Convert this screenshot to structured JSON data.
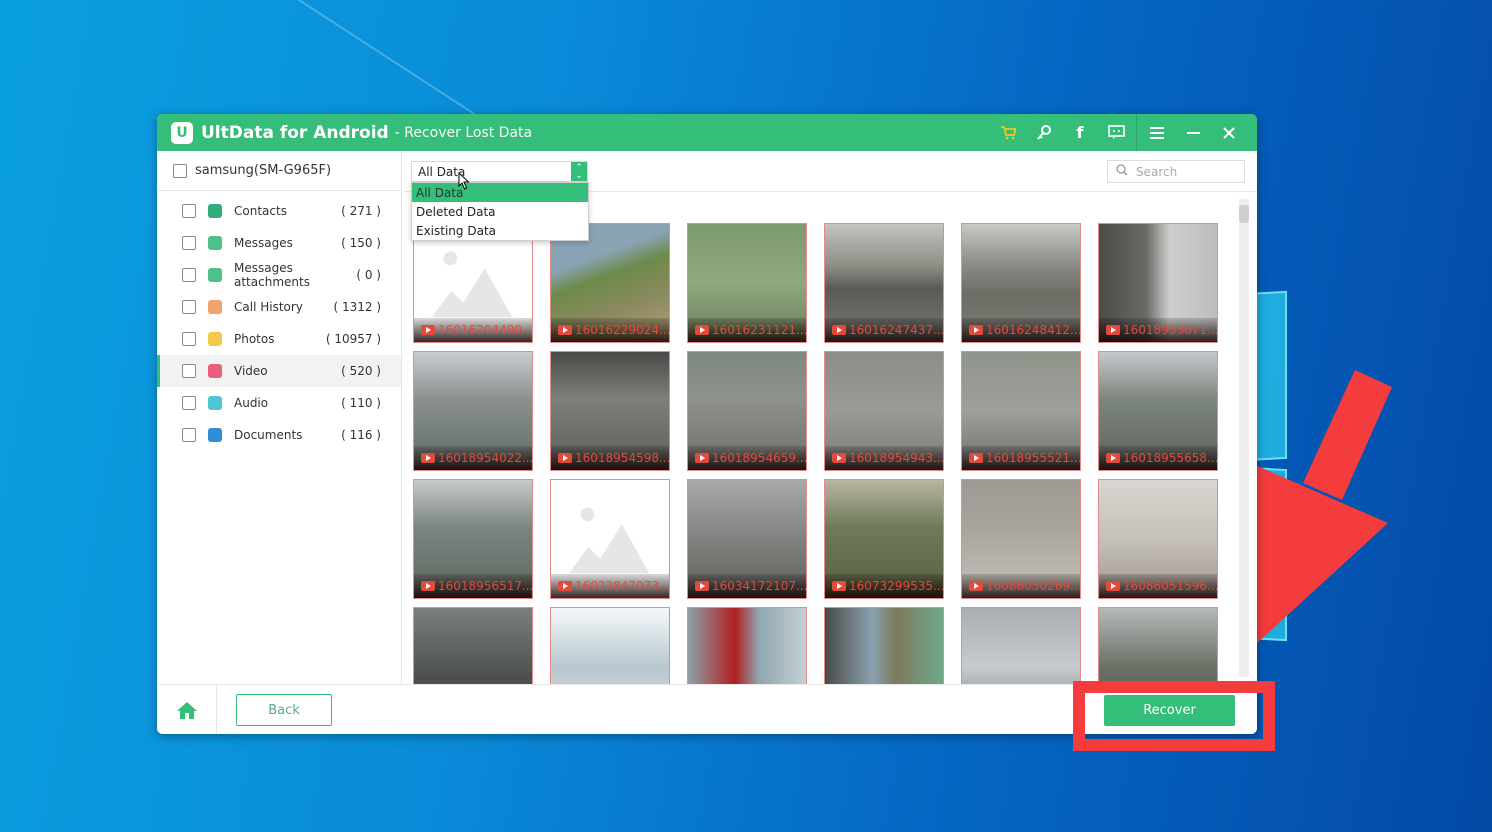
{
  "window": {
    "app_name": "UltData for Android",
    "subtitle": "- Recover Lost Data",
    "logo_letter": "U",
    "title_icons": [
      "cart-icon",
      "key-icon",
      "facebook-icon",
      "feedback-icon",
      "menu-icon",
      "minimize-icon",
      "close-icon"
    ]
  },
  "device": {
    "name": "samsung(SM-G965F)",
    "checked": false
  },
  "categories": [
    {
      "label": "Contacts",
      "count": "( 271 )",
      "icon": "contacts-icon",
      "color": "#2fae7a",
      "active": false
    },
    {
      "label": "Messages",
      "count": "( 150 )",
      "icon": "message-icon",
      "color": "#4cc28a",
      "active": false
    },
    {
      "label": "Messages attachments",
      "count": "( 0 )",
      "icon": "attachment-icon",
      "color": "#4cc28a",
      "active": false
    },
    {
      "label": "Call History",
      "count": "( 1312 )",
      "icon": "call-icon",
      "color": "#f0a36b",
      "active": false
    },
    {
      "label": "Photos",
      "count": "( 10957 )",
      "icon": "photo-icon",
      "color": "#f2c94c",
      "active": false
    },
    {
      "label": "Video",
      "count": "( 520 )",
      "icon": "video-icon",
      "color": "#e8607a",
      "active": true
    },
    {
      "label": "Audio",
      "count": "( 110 )",
      "icon": "audio-icon",
      "color": "#4fc6d6",
      "active": false
    },
    {
      "label": "Documents",
      "count": "( 116 )",
      "icon": "document-icon",
      "color": "#2f8fd4",
      "active": false
    }
  ],
  "filter": {
    "selected": "All Data",
    "options": [
      "All Data",
      "Deleted Data",
      "Existing Data"
    ],
    "open": true
  },
  "search": {
    "placeholder": "Search",
    "value": ""
  },
  "videos": [
    {
      "name": "16016204490...",
      "placeholder": true,
      "bg": "#ffffff"
    },
    {
      "name": "16016229024...",
      "placeholder": false,
      "bg": "linear-gradient(160deg,#8aa3b5 0%,#8aa3b5 30%,#6d8a4a 45%,#8c8a60 70%,#b7a07d 100%)"
    },
    {
      "name": "16016231121...",
      "placeholder": false,
      "bg": "linear-gradient(180deg,#7e9a70 0%,#8ea880 50%,#6c7f5a 100%)"
    },
    {
      "name": "16016247437...",
      "placeholder": false,
      "bg": "linear-gradient(180deg,#c4c4c0 0%,#8f8f88 35%,#5a5a55 55%,#7a7a74 100%)"
    },
    {
      "name": "16016248412...",
      "placeholder": false,
      "bg": "linear-gradient(180deg,#c9c9c6 0%,#8b8a84 35%,#6c6b64 60%,#7f7d77 100%)"
    },
    {
      "name": "16018953671...",
      "placeholder": false,
      "bg": "linear-gradient(90deg,#4a4a48 0%,#6a6a66 40%,#cfcfcf 60%,#bdbdbd 100%)"
    },
    {
      "name": "16018954022...",
      "placeholder": false,
      "bg": "linear-gradient(180deg,#c8cdd0 0%,#8a9190 40%,#5f6a66 100%)"
    },
    {
      "name": "16018954598...",
      "placeholder": false,
      "bg": "linear-gradient(180deg,#4a4a48 0%,#7d7f7a 40%,#5d5e58 100%)"
    },
    {
      "name": "16018954659...",
      "placeholder": false,
      "bg": "linear-gradient(180deg,#7c8a80 0%,#8f918c 40%,#6f706b 100%)"
    },
    {
      "name": "16018954943...",
      "placeholder": false,
      "bg": "linear-gradient(180deg,#8c8c88 0%,#9a9a96 50%,#7a7a75 100%)"
    },
    {
      "name": "16018955521...",
      "placeholder": false,
      "bg": "linear-gradient(180deg,#8f958c 0%,#9e9f98 50%,#6f706a 100%)"
    },
    {
      "name": "16018955658...",
      "placeholder": false,
      "bg": "linear-gradient(180deg,#c5c9cb 0%,#7d857f 40%,#5b625c 100%)"
    },
    {
      "name": "16018956517...",
      "placeholder": false,
      "bg": "linear-gradient(180deg,#c7cbcc 0%,#7b8580 40%,#5f665f 100%)"
    },
    {
      "name": "16022847073...",
      "placeholder": true,
      "bg": "#ffffff"
    },
    {
      "name": "16034172107...",
      "placeholder": false,
      "bg": "linear-gradient(180deg,#a8aaa8 0%,#7f827e 50%,#5e615c 100%)"
    },
    {
      "name": "16073299535...",
      "placeholder": false,
      "bg": "linear-gradient(180deg,#b9b6a3 0%,#6f7b58 40%,#58603f 100%)"
    },
    {
      "name": "16086050269...",
      "placeholder": false,
      "bg": "linear-gradient(180deg,#9c9a94 0%,#a8a49d 40%,#c6c2bb 100%)"
    },
    {
      "name": "16086051596...",
      "placeholder": false,
      "bg": "linear-gradient(180deg,#d8d6d2 0%,#c6c1b8 50%,#9e978d 100%)"
    },
    {
      "name": "",
      "placeholder": false,
      "bg": "linear-gradient(180deg,#7a7f80 0%,#4b4e4d 60%,#6a6c6a 100%)"
    },
    {
      "name": "",
      "placeholder": false,
      "bg": "linear-gradient(180deg,#f5f8fa 0%,#b8c7cf 50%,#d9e0e3 100%)"
    },
    {
      "name": "",
      "placeholder": false,
      "bg": "linear-gradient(90deg,#8fa0aa 0%,#b02020 40%,#8fa6b0 60%,#c4d0d4 100%)"
    },
    {
      "name": "",
      "placeholder": false,
      "bg": "linear-gradient(90deg,#4a4a48 0%,#8aa1b0 40%,#7d7a5c 60%,#6fa889 100%)"
    },
    {
      "name": "",
      "placeholder": false,
      "bg": "linear-gradient(180deg,#a9aeb0 0%,#c6cbce 50%,#737b7e 100%)"
    },
    {
      "name": "",
      "placeholder": false,
      "bg": "linear-gradient(180deg,#b6b9ba 0%,#6a7166 50%,#545a4f 100%)"
    }
  ],
  "footer": {
    "back_label": "Back",
    "recover_label": "Recover"
  },
  "colors": {
    "accent": "#35bd7a",
    "annotation": "#f53c3c",
    "video_caption": "#e34a3a"
  }
}
